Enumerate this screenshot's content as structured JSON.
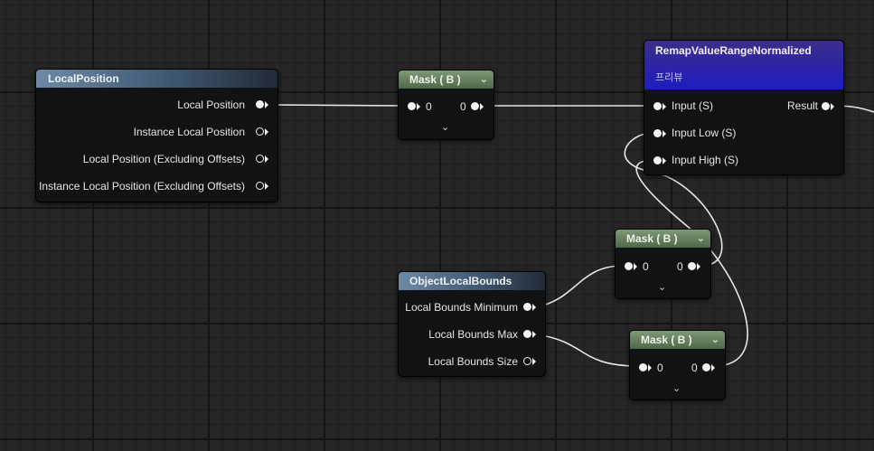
{
  "nodes": {
    "local_position": {
      "title": "LocalPosition",
      "outputs": [
        "Local Position",
        "Instance Local Position",
        "Local Position (Excluding Offsets)",
        "Instance Local Position (Excluding Offsets)"
      ]
    },
    "mask_top": {
      "title": "Mask ( B )",
      "input": "0",
      "output": "0",
      "chevron": "⌄",
      "expand": "⌄"
    },
    "remap": {
      "title": "RemapValueRangeNormalized",
      "subtitle": "프리뷰",
      "inputs": [
        "Input (S)",
        "Input Low (S)",
        "Input High (S)"
      ],
      "output": "Result"
    },
    "mask_mid": {
      "title": "Mask ( B )",
      "input": "0",
      "output": "0",
      "chevron": "⌄",
      "expand": "⌄"
    },
    "object_bounds": {
      "title": "ObjectLocalBounds",
      "outputs": [
        "Local Bounds Minimum",
        "Local Bounds Max",
        "Local Bounds Size"
      ]
    },
    "mask_bot": {
      "title": "Mask ( B )",
      "input": "0",
      "output": "0",
      "chevron": "⌄",
      "expand": "⌄"
    }
  },
  "colors": {
    "wire": "#e8e8e8",
    "pin": "#f2f2f2",
    "mask_header": "#5f7c58",
    "remap_header": "#2420b8"
  }
}
